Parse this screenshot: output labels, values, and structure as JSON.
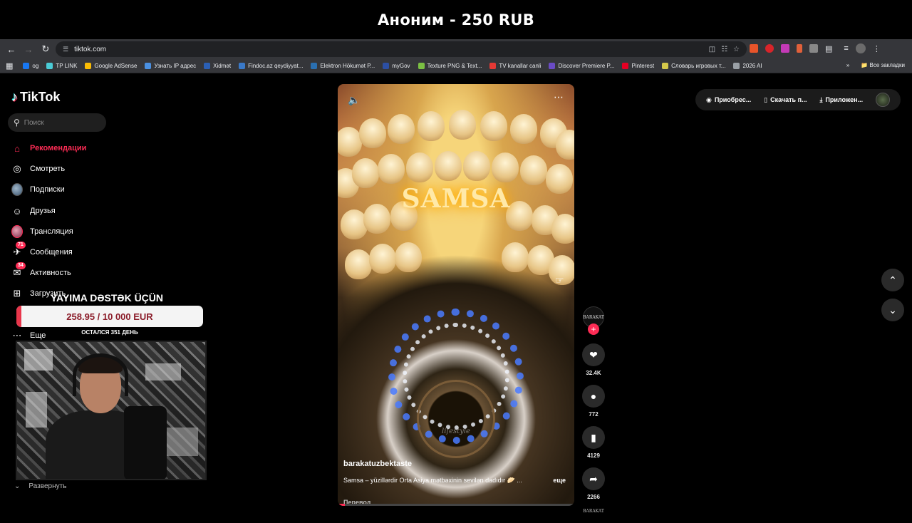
{
  "stream": {
    "banner": "Аноним - 250 RUB",
    "donation_title": "YAYIMA DƏSTƏK ÜÇÜN",
    "donation_amount": "258.95 / 10 000 EUR",
    "donation_progress": 0.026,
    "donation_remaining": "ОСТАЛСЯ 351 ДЕНЬ"
  },
  "browser": {
    "url": "tiktok.com",
    "bookmarks": [
      {
        "label": "og",
        "color": "#1877f2"
      },
      {
        "label": "TP LINK",
        "color": "#4acbd6"
      },
      {
        "label": "Google AdSense",
        "color": "#fbbc04"
      },
      {
        "label": "Узнать IP адрес",
        "color": "#4a90e2"
      },
      {
        "label": "Xidmət",
        "color": "#2b5fb4"
      },
      {
        "label": "Findoc.az qeydiyyat...",
        "color": "#3a79c8"
      },
      {
        "label": "Elektron Hökumət P...",
        "color": "#2a6fb0"
      },
      {
        "label": "myGov",
        "color": "#2c4fa3"
      },
      {
        "label": "Texture PNG & Text...",
        "color": "#7bc043"
      },
      {
        "label": "TV kanallar canli",
        "color": "#e53935"
      },
      {
        "label": "Discover Premiere P...",
        "color": "#6a4bc4"
      },
      {
        "label": "Pinterest",
        "color": "#e60023"
      },
      {
        "label": "Словарь игровых т...",
        "color": "#d4c84a"
      },
      {
        "label": "2026 AI",
        "color": "#9aa0a6"
      }
    ],
    "all_bookmarks": "Все закладки"
  },
  "tiktok": {
    "logo": "TikTok",
    "search_placeholder": "Поиск",
    "nav": [
      {
        "label": "Рекомендации",
        "icon": "home-icon",
        "active": true
      },
      {
        "label": "Смотреть",
        "icon": "compass-icon"
      },
      {
        "label": "Подписки",
        "icon": "avatar-icon"
      },
      {
        "label": "Друзья",
        "icon": "friends-icon"
      },
      {
        "label": "Трансляция",
        "icon": "live-icon"
      },
      {
        "label": "Сообщения",
        "icon": "messages-icon",
        "badge": "71"
      },
      {
        "label": "Активность",
        "icon": "activity-icon",
        "badge": "34"
      },
      {
        "label": "Загрузить",
        "icon": "upload-icon"
      },
      {
        "label": "Еще",
        "icon": "more-icon"
      }
    ],
    "expand_label": "Развернуть",
    "top_actions": [
      "Приобрес...",
      "Скачать п...",
      "Приложен..."
    ],
    "video": {
      "overlay_text": "SAMSA",
      "watermark": "lifestyle",
      "username": "barakatuzbektaste",
      "caption": "Samsa – yüzillərdir Orta Asiya mətbəxinin sevilən dadıdır 🥟 ...",
      "more": "еще",
      "translate": "Перевод"
    },
    "author_avatar_text": "BARAKAT",
    "music_text": "BARAKAT",
    "stats": {
      "likes": "32.4K",
      "comments": "772",
      "saves": "4129",
      "shares": "2266"
    }
  }
}
